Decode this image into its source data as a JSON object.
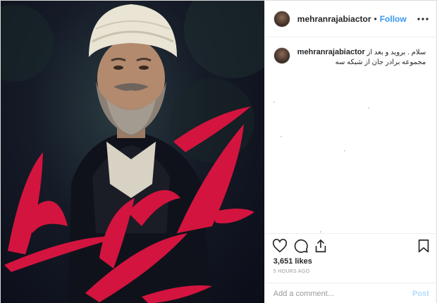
{
  "post": {
    "image_alt_icon": "photo",
    "header": {
      "username": "mehranrajabiactor",
      "separator": "•",
      "follow_label": "Follow",
      "more_icon": "ellipsis-icon"
    },
    "caption": {
      "username": "mehranrajabiactor",
      "line1": "سلام . بروید و بعد از",
      "line2": "مجموعه برادر جان از شبکه سه"
    },
    "actions": {
      "like_icon": "heart-icon",
      "comment_icon": "comment-icon",
      "share_icon": "share-icon",
      "save_icon": "bookmark-icon"
    },
    "likes": "3,651 likes",
    "timestamp": "5 HOURS AGO",
    "comment_box": {
      "placeholder": "Add a comment...",
      "post_label": "Post"
    },
    "colors": {
      "follow": "#3897f0",
      "calligraphy": "#d3143f",
      "post_disabled": "#b3dbff"
    }
  }
}
